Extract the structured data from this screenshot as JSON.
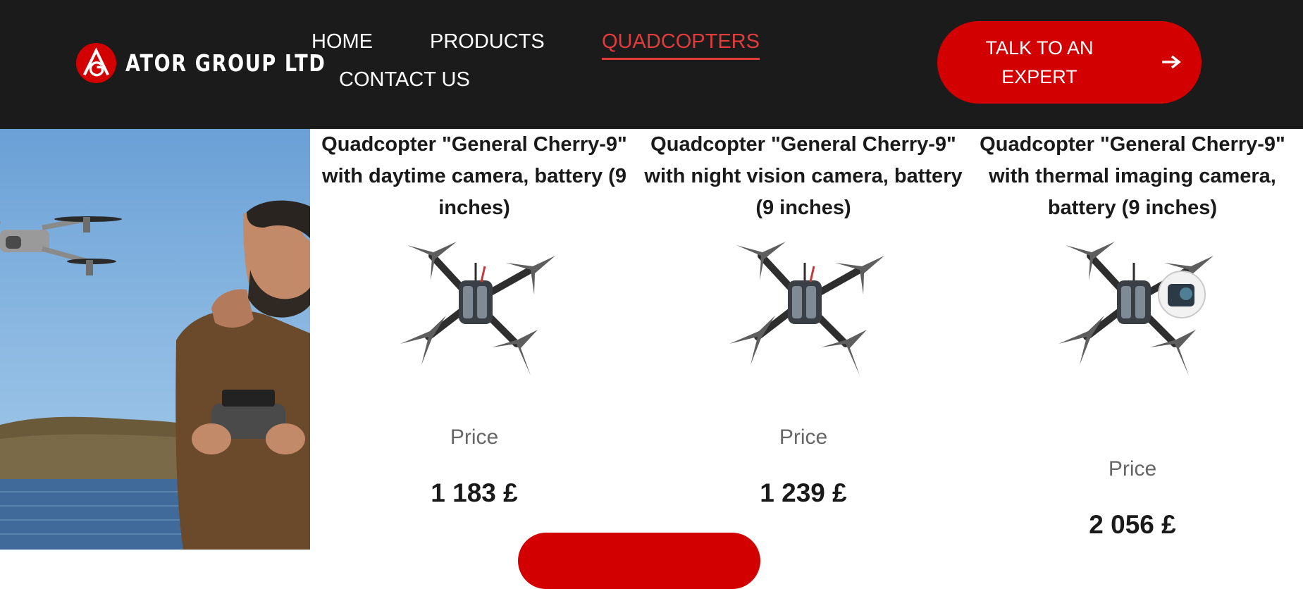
{
  "brand": {
    "name": "ATOR GROUP LTD",
    "accent": "#d20000"
  },
  "nav": {
    "home": "HOME",
    "products": "PRODUCTS",
    "quadcopters": "QUADCOPTERS",
    "contact": "CONTACT US",
    "active_color": "#e23b3b"
  },
  "cta": {
    "label": "TALK TO AN\nEXPERT",
    "icon": "arrow-right-icon"
  },
  "products": [
    {
      "title": "Quadcopter \"General Cherry-9\" with daytime camera, battery (9 inches)",
      "price_label": "Price",
      "price": "1 183 £"
    },
    {
      "title": "Quadcopter \"General Cherry-9\" with night vision camera, battery (9 inches)",
      "price_label": "Price",
      "price": "1 239 £"
    },
    {
      "title": "Quadcopter \"General Cherry-9\" with thermal imaging camera, battery (9 inches)",
      "price_label": "Price",
      "price": "2 056 £"
    }
  ]
}
